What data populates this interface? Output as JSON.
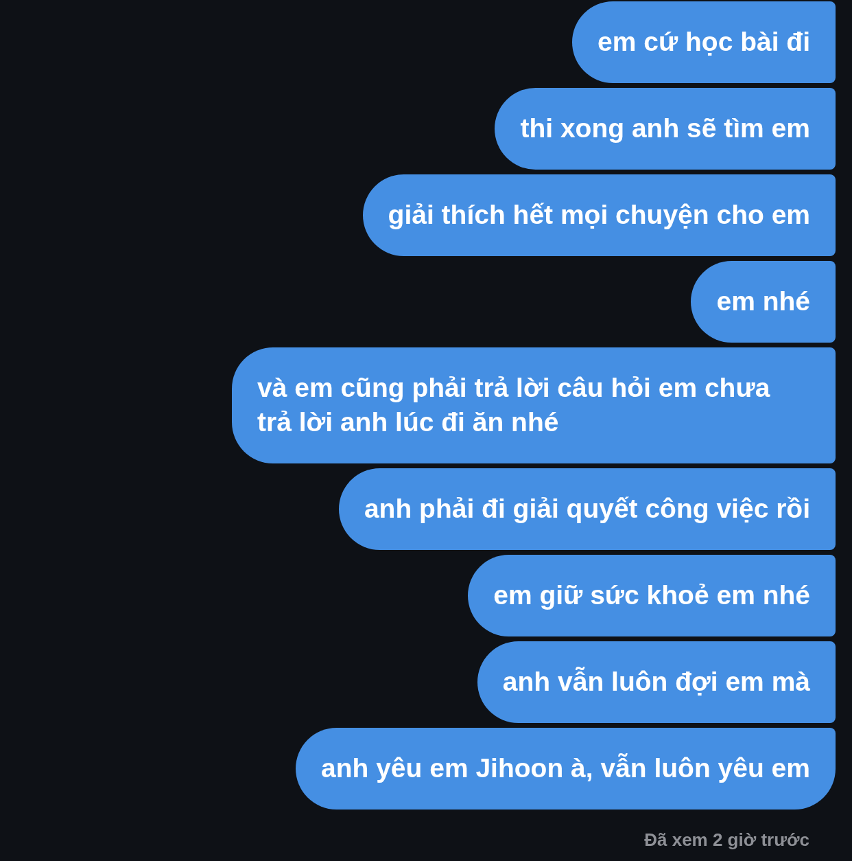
{
  "messages": [
    {
      "text": "em cứ học bài đi",
      "last_in_group": false
    },
    {
      "text": "thi xong anh sẽ tìm em",
      "last_in_group": false
    },
    {
      "text": "giải thích hết mọi chuyện cho em",
      "last_in_group": false
    },
    {
      "text": "em nhé",
      "last_in_group": false
    },
    {
      "text": "và em cũng phải trả lời câu hỏi em chưa trả lời anh lúc đi ăn nhé",
      "last_in_group": false
    },
    {
      "text": "anh phải đi giải quyết công việc rồi",
      "last_in_group": false
    },
    {
      "text": "em giữ sức khoẻ em nhé",
      "last_in_group": false
    },
    {
      "text": "anh vẫn luôn đợi em mà",
      "last_in_group": false
    },
    {
      "text": "anh yêu em Jihoon à, vẫn luôn yêu em",
      "last_in_group": true
    }
  ],
  "status": {
    "text": "Đã xem 2 giờ trước"
  }
}
